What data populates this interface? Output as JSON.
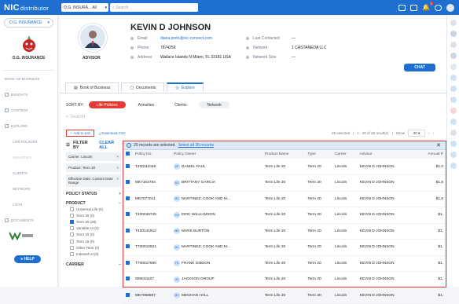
{
  "topbar": {
    "logo": "NIC",
    "logo_sub": "distributor",
    "agency": "O.G. INSURA... All",
    "search_placeholder": "Search",
    "notifications": "1"
  },
  "leftnav": {
    "agency_select": "O.G. INSURANCE",
    "brand": "O.G. INSURANCE",
    "items": [
      {
        "label": "BOOK OF BUSINESS"
      },
      {
        "label": "INSIGHTS"
      },
      {
        "label": "CONTENT"
      },
      {
        "label": "EXPLORE"
      },
      {
        "label": "LIFE POLICIES"
      },
      {
        "label": "ANNUITIES"
      },
      {
        "label": "CLIENTS"
      },
      {
        "label": "NETWORK"
      },
      {
        "label": "LISTS"
      },
      {
        "label": "DOCUMENTS"
      }
    ],
    "help": "HELP"
  },
  "profile": {
    "name": "KEVIN D JOHNSON",
    "role": "ADVISOR",
    "email_label": "Email",
    "email": "diana.pinto@nic-connect.com",
    "phone_label": "Phone",
    "phone": "7874259",
    "address_label": "Address",
    "address": "Wallace Islands N Miami, FL 33181 USA",
    "last_contacted_label": "Last Contacted",
    "last_contacted": "—",
    "network_label": "Network",
    "network": "1 CASTANEDA LLC",
    "network_size_label": "Network Size",
    "network_size": "—",
    "chat": "CHAT"
  },
  "tabs": [
    {
      "label": "Book of Business"
    },
    {
      "label": "Documents"
    },
    {
      "label": "Explore"
    }
  ],
  "explore": {
    "sort_by": "SORT BY:",
    "pills": [
      "Life Policies",
      "Annuities",
      "Clients",
      "Network"
    ],
    "search_placeholder": "Search",
    "add_to_list": "Add to List",
    "download_csv": "Download CSV",
    "selected_count": "20 selected",
    "range": "1 - 20 of 28 result(s)",
    "show_label": "Show",
    "show_value": "20"
  },
  "filters": {
    "title": "FILTER BY",
    "clear": "CLEAR ALL",
    "chips": [
      "Carrier: Lincoln",
      "Product: Term 20",
      "Effective Date: Custom Date Range"
    ],
    "policy_status": "POLICY STATUS",
    "product": "PRODUCT",
    "product_options": [
      {
        "label": "Universal Life (0)",
        "on": false
      },
      {
        "label": "Term 30 (0)",
        "on": false
      },
      {
        "label": "Term 20 (28)",
        "on": true
      },
      {
        "label": "Variable UI (0)",
        "on": false
      },
      {
        "label": "Term 10 (0)",
        "on": false
      },
      {
        "label": "Term 15 (0)",
        "on": false
      },
      {
        "label": "Other Term (0)",
        "on": false
      },
      {
        "label": "Indexed UI (0)",
        "on": false
      }
    ],
    "carrier": "CARRIER"
  },
  "table": {
    "banner_text": "20 records are selected.",
    "banner_link": "Select all 28 records",
    "columns": [
      "Policy No.",
      "Policy Owner",
      "Product Name",
      "Type",
      "Carrier",
      "Advisor",
      "Annual P"
    ],
    "rows": [
      {
        "policy": "T400111046",
        "initials": "DP",
        "owner": "DANIEL PAUL",
        "product": "Term Life 20",
        "type": "Term 20",
        "carrier": "Lincoln",
        "advisor": "KEVIN D JOHNSON",
        "annual": "$1,0"
      },
      {
        "policy": "ME7102784",
        "initials": "BG",
        "owner": "BRITTANY GARCIA",
        "product": "Term Life 20",
        "type": "Term 20",
        "carrier": "Lincoln",
        "advisor": "KEVIN D JOHNSON",
        "annual": "$1,8"
      },
      {
        "policy": "ME7077011",
        "initials": "MC",
        "owner": "MARTINEZ, COOK AND M...",
        "product": "Term Life 20",
        "type": "Term 20",
        "carrier": "Lincoln",
        "advisor": "KEVIN D JOHNSON",
        "annual": "$1,5"
      },
      {
        "policy": "T400048745",
        "initials": "EW",
        "owner": "ERIC WILLIAMSON",
        "product": "Term Life 20",
        "type": "Term 20",
        "carrier": "Lincoln",
        "advisor": "KEVIN D JOHNSON",
        "annual": "$1,"
      },
      {
        "policy": "T400141912",
        "initials": "MB",
        "owner": "MARK BURTON",
        "product": "Term Life 20",
        "type": "Term 20",
        "carrier": "Lincoln",
        "advisor": "KEVIN D JOHNSON",
        "annual": "$1,"
      },
      {
        "policy": "T700010821",
        "initials": "MC",
        "owner": "MARTINEZ, COOK AND M...",
        "product": "Term Life 20",
        "type": "Term 20",
        "carrier": "Lincoln",
        "advisor": "KEVIN D JOHNSON",
        "annual": "$1,"
      },
      {
        "policy": "T700017690",
        "initials": "FG",
        "owner": "FRANK GIBSON",
        "product": "Term Life 20",
        "type": "Term 20",
        "carrier": "Lincoln",
        "advisor": "KEVIN D JOHNSON",
        "annual": "$1,"
      },
      {
        "policy": "009044107",
        "initials": "JG",
        "owner": "JACKSON GROUP",
        "product": "Term Life 20",
        "type": "Term 20",
        "carrier": "Lincoln",
        "advisor": "KEVIN D JOHNSON",
        "annual": "$1,"
      },
      {
        "policy": "ME7088597",
        "initials": "MH",
        "owner": "MEGHAN HALL",
        "product": "Term Life 20",
        "type": "Term 20",
        "carrier": "Lincoln",
        "advisor": "KEVIN D JOHNSON",
        "annual": "$1,"
      }
    ]
  },
  "colors": {
    "primary": "#1e6fd0",
    "accent": "#e53935"
  }
}
